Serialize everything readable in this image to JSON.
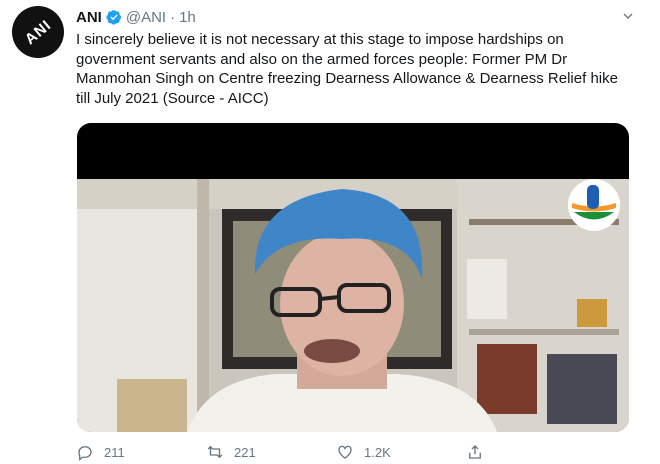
{
  "tweet": {
    "display_name": "ANI",
    "handle": "@ANI",
    "separator": "·",
    "time": "1h",
    "avatar_logo_text": "ANI",
    "text": "I sincerely believe it is not necessary at this stage to impose hardships on government servants and also on the armed forces people: Former PM Dr Manmohan Singh on Centre freezing Dearness Allowance & Dearness Relief hike till July 2021 (Source - AICC)"
  },
  "actions": {
    "reply_count": "211",
    "retweet_count": "221",
    "like_count": "1.2K"
  },
  "icons": [
    "verified-badge-icon",
    "caret-down-icon",
    "reply-icon",
    "retweet-icon",
    "like-icon",
    "share-icon"
  ],
  "colors": {
    "verified": "#1da1f2",
    "muted_text": "#657786",
    "turban": "#3f86c9"
  }
}
